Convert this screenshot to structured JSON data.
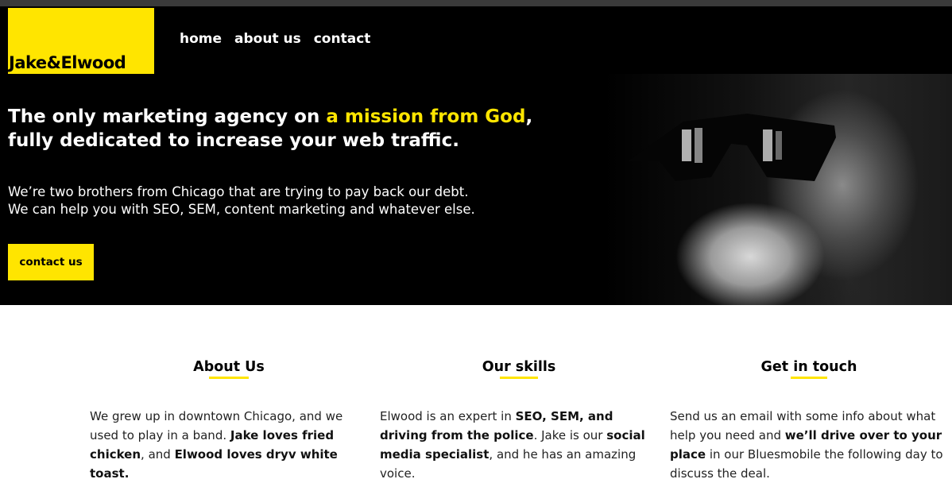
{
  "brand": {
    "logo_text": "Jake&Elwood",
    "accent_color": "#ffe500"
  },
  "nav": {
    "items": [
      "home",
      "about us",
      "contact"
    ]
  },
  "hero": {
    "headline_part1": "The only marketing agency on ",
    "headline_highlight": "a mission from God",
    "headline_part2": ",",
    "headline_line2": "fully dedicated to increase your web traffic.",
    "sub_line1": "We’re two brothers from Chicago that are trying to pay back our debt.",
    "sub_line2": "We can help you with SEO, SEM, content marketing and whatever else.",
    "cta_label": "contact us",
    "image": "man-with-sunglasses-and-beard-photo"
  },
  "sections": [
    {
      "title": "About Us",
      "text": [
        "We grew up in downtown Chicago, and we used to play in a band. ",
        "Jake loves fried chicken",
        ", and ",
        "Elwood loves dryv white toast."
      ]
    },
    {
      "title": "Our skills",
      "text": [
        "Elwood is an expert in ",
        "SEO, SEM, and driving from the police",
        ". Jake is our ",
        "social media specialist",
        ", and he has an amazing voice."
      ]
    },
    {
      "title": "Get in touch",
      "text": [
        "Send us an email with some info about what help you need and ",
        "we’ll drive over to your place",
        " in our Bluesmobile the following day to discuss the deal."
      ]
    }
  ]
}
